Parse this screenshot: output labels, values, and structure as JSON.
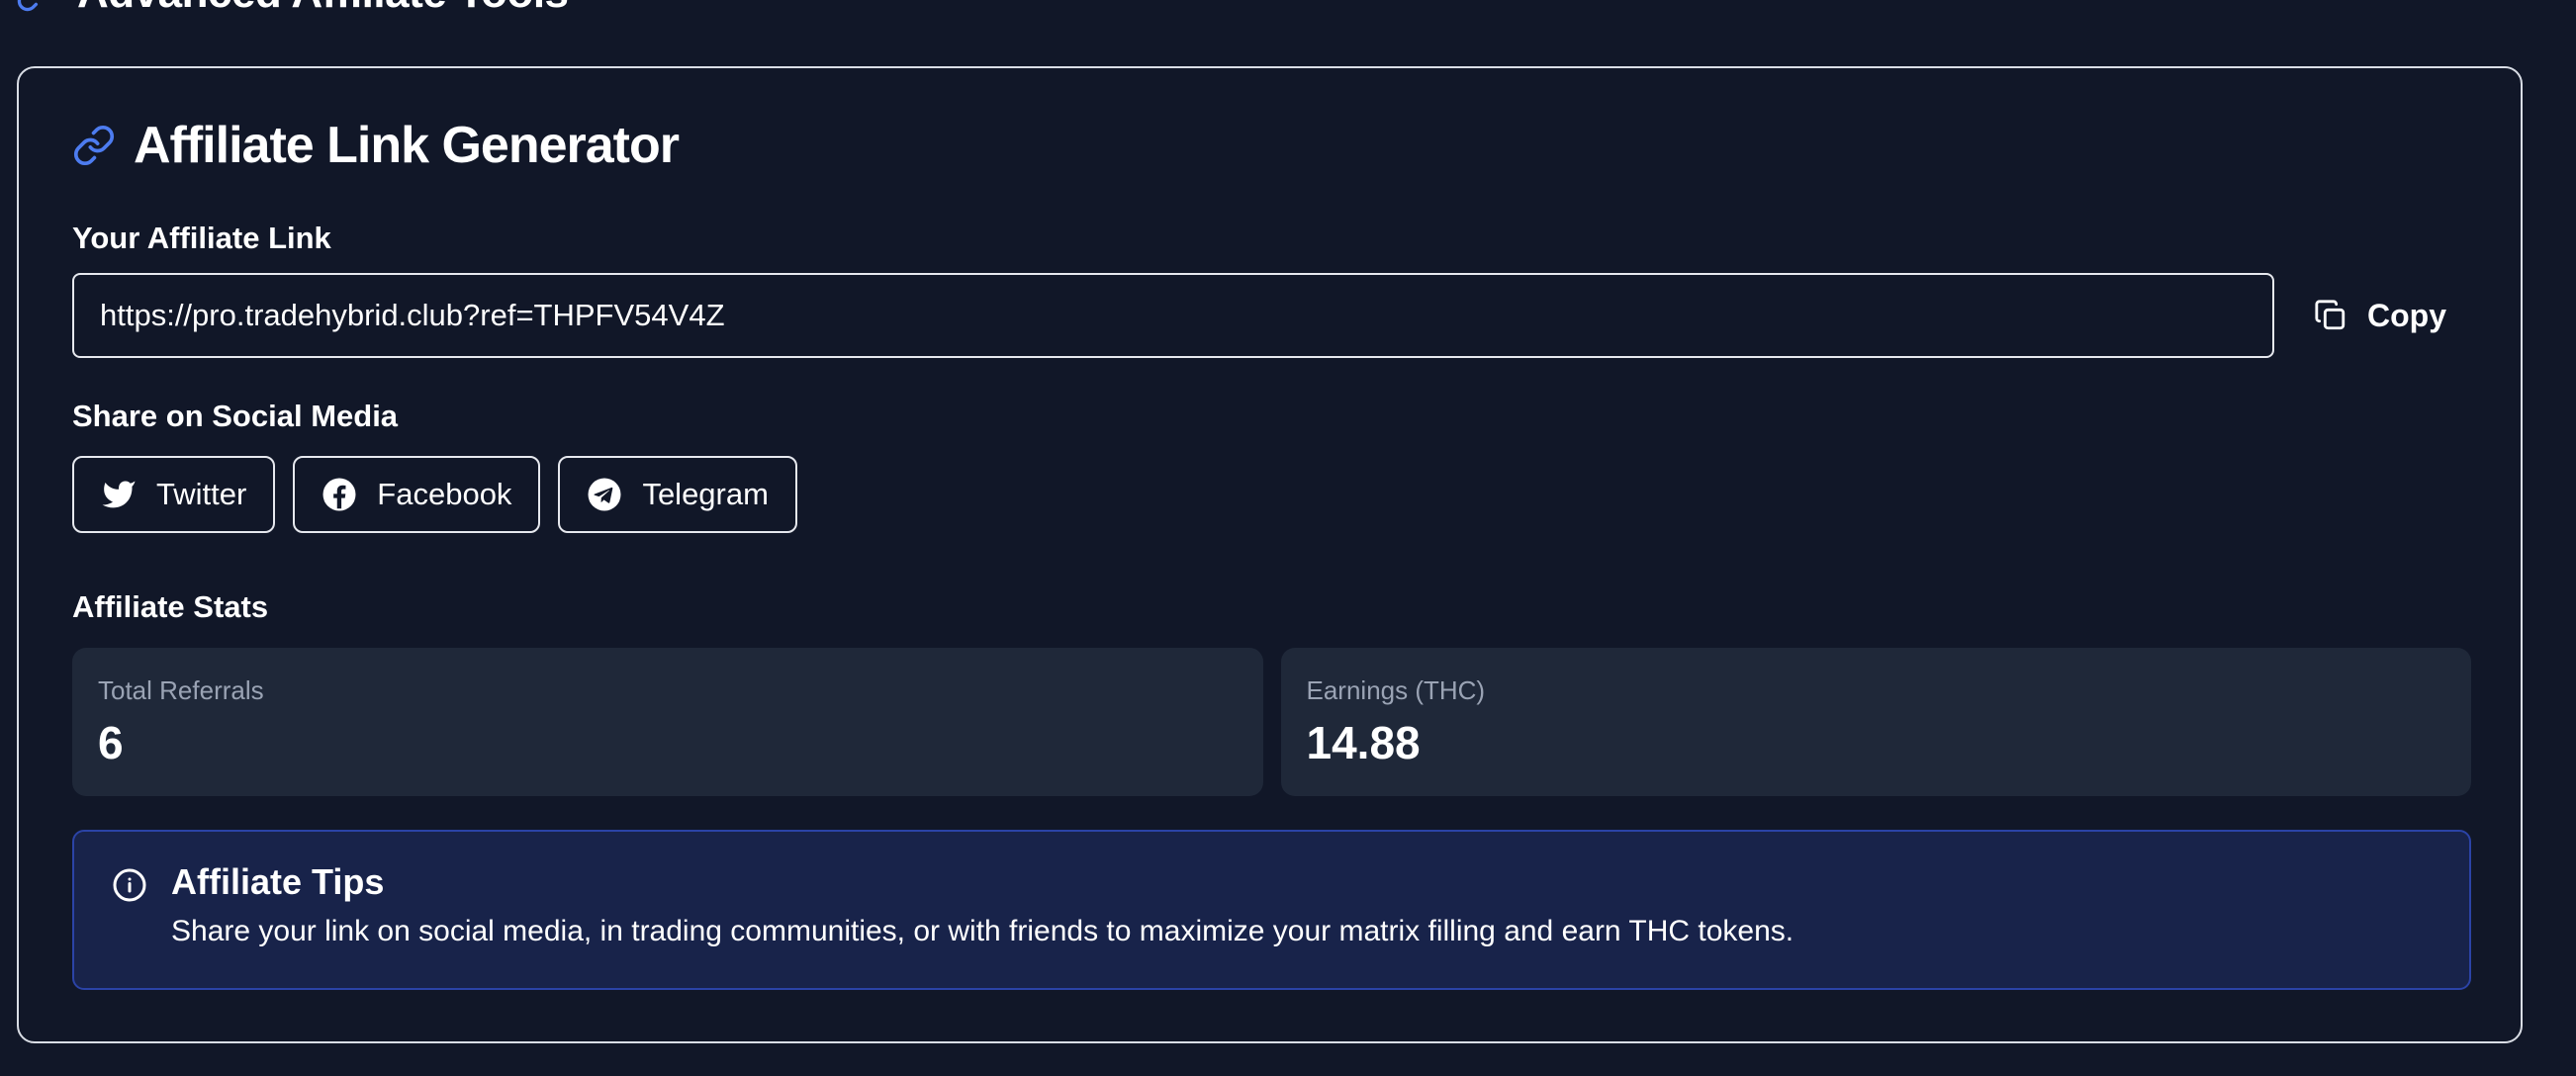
{
  "header": {
    "title": "Advanced Affiliate Tools",
    "icon": "link-icon"
  },
  "generator": {
    "title": "Affiliate Link Generator",
    "icon": "link-icon",
    "link_label": "Your Affiliate Link",
    "link_value": "https://pro.tradehybrid.club?ref=THPFV54V4Z",
    "copy_label": "Copy",
    "copy_icon": "copy-icon"
  },
  "social": {
    "label": "Share on Social Media",
    "buttons": [
      {
        "label": "Twitter",
        "icon": "twitter-icon"
      },
      {
        "label": "Facebook",
        "icon": "facebook-icon"
      },
      {
        "label": "Telegram",
        "icon": "telegram-icon"
      }
    ]
  },
  "stats": {
    "label": "Affiliate Stats",
    "items": [
      {
        "label": "Total Referrals",
        "value": "6"
      },
      {
        "label": "Earnings (THC)",
        "value": "14.88"
      }
    ]
  },
  "tips": {
    "icon": "info-icon",
    "title": "Affiliate Tips",
    "text": "Share your link on social media, in trading communities, or with friends to maximize your matrix filling and earn THC tokens."
  },
  "colors": {
    "background": "#111728",
    "accent": "#4d7cf0",
    "stat_card": "#1f2839",
    "tips_background": "#18234a",
    "tips_border": "#2b43a6"
  }
}
